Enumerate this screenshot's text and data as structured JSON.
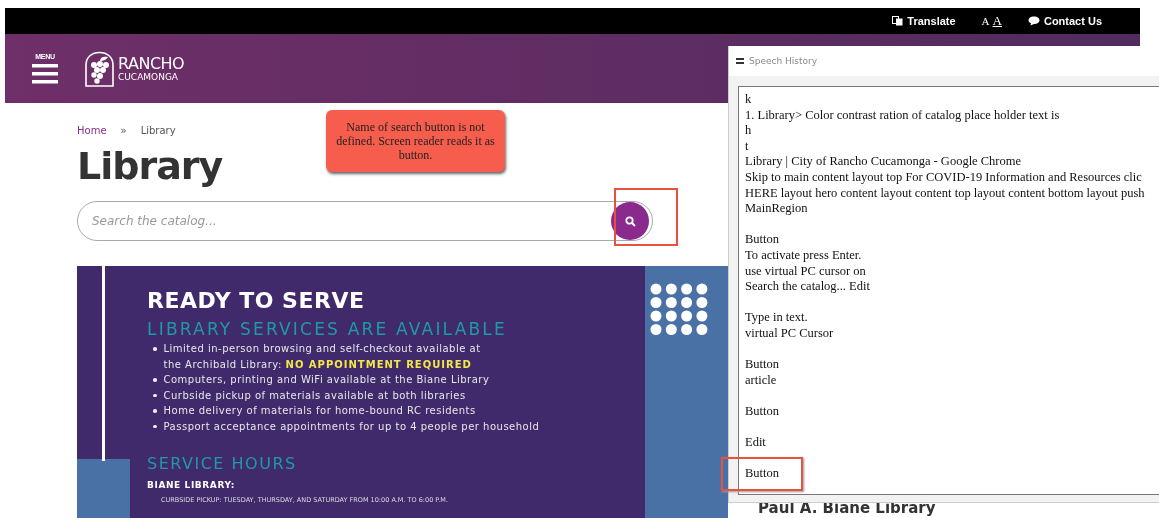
{
  "top_bar": {
    "links": [
      {
        "kind": "translate",
        "label": "Translate"
      },
      {
        "kind": "text_size",
        "label": "A",
        "label_large": "A"
      },
      {
        "kind": "contact",
        "label": "Contact Us"
      }
    ]
  },
  "header": {
    "menu_label": "MENU",
    "logo_line1": "RANCHO",
    "logo_line2": "CUCAMONGA"
  },
  "breadcrumb": [
    {
      "label": "Home",
      "link": true
    },
    {
      "label": "»",
      "link": false
    },
    {
      "label": "Library",
      "link": false
    }
  ],
  "title": "Library",
  "search": {
    "placeholder": "Search the catalog...",
    "highlighted": true
  },
  "annotation": {
    "text": "Name of search button is not defined. Screen reader reads it as button."
  },
  "banner": {
    "heading": "READY TO SERVE",
    "subheading": "LIBRARY SERVICES ARE AVAILABLE",
    "bullets": [
      "Limited in-person browsing and self-checkout available at the Archibald Library: **NO APPOINTMENT REQUIRED**",
      "Computers, printing and WiFi available at the Biane Library",
      "Curbside pickup of materials available at both libraries",
      "Home delivery of materials for home-bound RC residents",
      "Passport acceptance appointments for up to 4 people per household"
    ],
    "hours_heading": "SERVICE HOURS",
    "location": "BIANE LIBRARY:",
    "hours_line": "CURBSIDE PICKUP: TUESDAY, THURSDAY, AND SATURDAY FROM 10:00 A.M. TO 6:00 P.M."
  },
  "side_heading": "Paul A. Biane Library",
  "speech_history": {
    "title": "Speech History",
    "groups": [
      {
        "lines": [
          "k",
          "1. Library> Color contrast ration of catalog place holder text is",
          "h",
          "t",
          "Library | City of Rancho Cucamonga - Google Chrome",
          "Skip to main content layout top For COVID-19 Information and Resources clic",
          "HERE layout hero content layout content top layout content bottom layout push",
          "MainRegion"
        ],
        "highlighted": false
      },
      {
        "lines": [
          "Button",
          "To activate press Enter.",
          "use virtual PC cursor on",
          "Search the catalog... Edit"
        ],
        "highlighted": false
      },
      {
        "lines": [
          "Type in text.",
          "virtual PC Cursor"
        ],
        "highlighted": false
      },
      {
        "lines": [
          "Button",
          "article"
        ],
        "highlighted": false
      },
      {
        "lines": [
          "Button"
        ],
        "highlighted": false
      },
      {
        "lines": [
          "Edit"
        ],
        "highlighted": false
      },
      {
        "lines": [
          "Button"
        ],
        "highlighted": true
      }
    ]
  }
}
